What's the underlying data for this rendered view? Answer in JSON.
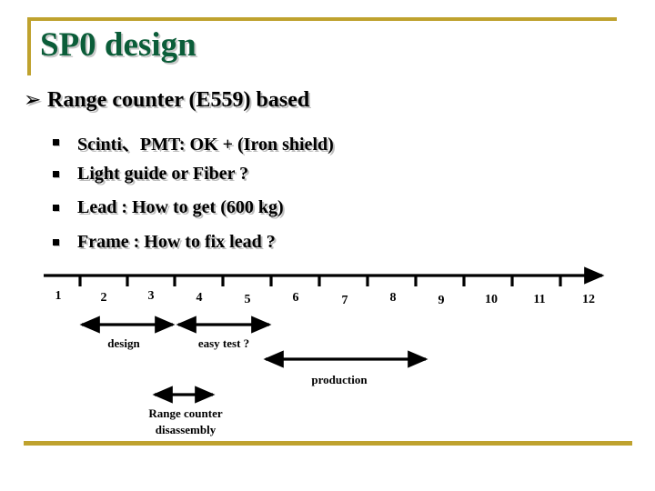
{
  "slide": {
    "title": "SP0 design",
    "accent_gold": "#BFA22E",
    "title_green": "#0B5D39"
  },
  "bullets": {
    "level1": {
      "marker": "chevron-double-right-marker",
      "marker_glyph": "➢",
      "text": "Range counter (E559) based"
    },
    "level2": [
      {
        "marker": "square-marker",
        "text": "Scinti、PMT: OK + (Iron shield)"
      },
      {
        "marker": "square-marker",
        "text": "Light guide or Fiber ?"
      },
      {
        "marker": "square-marker",
        "text": "Lead  : How to get (600 kg)"
      },
      {
        "marker": "square-marker",
        "text": "Frame : How to fix lead ?"
      }
    ]
  },
  "timeline": {
    "axis_label_end_arrow": true,
    "ticks": [
      "1",
      "2",
      "3",
      "4",
      "5",
      "6",
      "7",
      "8",
      "9",
      "10",
      "11",
      "12"
    ],
    "annotations": [
      {
        "name": "design",
        "label": "design"
      },
      {
        "name": "easy-test",
        "label": "easy test  ?"
      },
      {
        "name": "production",
        "label": "production"
      },
      {
        "name": "range-counter-disassembly",
        "label_line1": "Range counter",
        "label_line2": "disassembly"
      }
    ]
  }
}
